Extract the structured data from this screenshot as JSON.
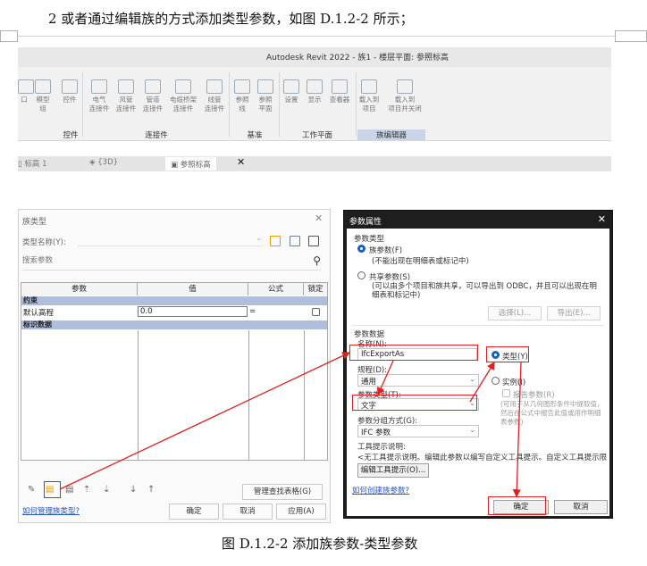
{
  "document": {
    "heading": "2 或者通过编辑族的方式添加类型参数，如图 D.1.2-2 所示；",
    "caption": "图 D.1.2-2 添加族参数-类型参数"
  },
  "revit": {
    "window_title": "Autodesk Revit 2022 - 族1 - 楼层平面: 参照标高",
    "ribbon_buttons": [
      {
        "label": "口",
        "icon": "square-icon"
      },
      {
        "label": "模型\n组",
        "icon": "model-group-icon"
      },
      {
        "label": "控件",
        "icon": "control-icon"
      },
      {
        "label": "电气\n连接件",
        "icon": "electrical-connector-icon"
      },
      {
        "label": "风管\n连接件",
        "icon": "duct-connector-icon"
      },
      {
        "label": "管道\n连接件",
        "icon": "pipe-connector-icon"
      },
      {
        "label": "电缆桥架\n连接件",
        "icon": "cable-tray-connector-icon"
      },
      {
        "label": "线管\n连接件",
        "icon": "conduit-connector-icon"
      },
      {
        "label": "参照\n线",
        "icon": "reference-line-icon"
      },
      {
        "label": "参照\n平面",
        "icon": "reference-plane-icon"
      },
      {
        "label": "设置",
        "icon": "set-workplane-icon"
      },
      {
        "label": "显示",
        "icon": "show-workplane-icon"
      },
      {
        "label": "查看器",
        "icon": "viewer-icon"
      },
      {
        "label": "载入到\n项目",
        "icon": "load-into-project-icon"
      },
      {
        "label": "载入到\n项目并关闭",
        "icon": "load-and-close-icon"
      }
    ],
    "ribbon_groups": [
      "控件",
      "连接件",
      "基准",
      "工作平面",
      "族编辑器"
    ],
    "view_tabs": [
      "标高 1",
      "{3D}",
      "参照标高"
    ]
  },
  "family_types": {
    "title": "族类型",
    "type_name_label": "类型名称(Y):",
    "search_placeholder": "搜索参数",
    "columns": [
      "参数",
      "值",
      "公式",
      "锁定"
    ],
    "groups": [
      {
        "name": "约束",
        "rows": [
          {
            "name": "默认高程",
            "value": "0.0",
            "formula": "="
          }
        ]
      },
      {
        "name": "标识数据",
        "rows": []
      }
    ],
    "manage_lookup_button": "管理查找表格(G)",
    "help_link": "如何管理族类型?",
    "ok": "确定",
    "cancel": "取消",
    "apply": "应用(A)"
  },
  "param_props": {
    "title": "参数属性",
    "param_type_label": "参数类型",
    "family_param": "族参数(F)",
    "family_param_note": "(不能出现在明细表或标记中)",
    "shared_param": "共享参数(S)",
    "shared_param_note": "(可以由多个项目和族共享，可以导出到 ODBC，并且可以出现在明细表和标记中)",
    "select_button": "选择(L)...",
    "export_button": "导出(E)...",
    "param_data_label": "参数数据",
    "name_label": "名称(N):",
    "name_value": "IfcExportAs",
    "type_radio": "类型(Y)",
    "instance_radio": "实例(I)",
    "discipline_label": "规程(D):",
    "discipline_value": "通用",
    "param_kind_label": "参数类型(T):",
    "param_kind_value": "文字",
    "report_param": "报告参数(R)",
    "report_note": "(可用于从几何图形条件中提取值，然后在公式中报告此值或用作明细表参数)",
    "group_label": "参数分组方式(G):",
    "group_value": "IFC 参数",
    "tooltip_label": "工具提示说明:",
    "tooltip_text": "<无工具提示说明。编辑此参数以编写自定义工具提示。自定义工具提示限",
    "edit_tooltip_button": "编辑工具提示(O)...",
    "help_link": "如何创建族参数?",
    "ok": "确定",
    "cancel": "取消"
  },
  "colors": {
    "highlight": "#e02020",
    "group_row": "#aebedb",
    "radio_selected": "#1a5fbf",
    "link": "#2a56c6"
  }
}
